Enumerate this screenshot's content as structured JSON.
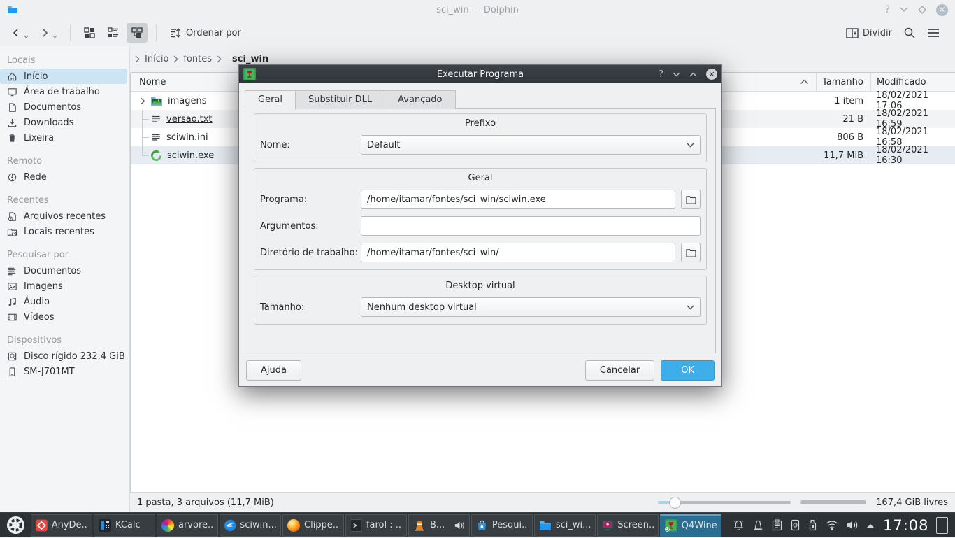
{
  "colors": {
    "accent": "#3daee9",
    "panel_bg": "#2c3136",
    "dialog_titlebar": "#31363b",
    "selection": "#cde4f5",
    "active_task": "#2b6d91"
  },
  "window": {
    "title": "sci_win — Dolphin",
    "help_glyph": "?"
  },
  "toolbar": {
    "sort_label": "Ordenar por",
    "split_label": "Dividir"
  },
  "breadcrumb": {
    "home": "Início",
    "parent": "fontes",
    "current": "sci_win"
  },
  "sidebar": {
    "sections": [
      {
        "title": "Locais",
        "items": [
          {
            "label": "Início",
            "icon": "home-icon",
            "selected": true
          },
          {
            "label": "Área de trabalho",
            "icon": "desktop-icon"
          },
          {
            "label": "Documentos",
            "icon": "documents-icon"
          },
          {
            "label": "Downloads",
            "icon": "downloads-icon"
          },
          {
            "label": "Lixeira",
            "icon": "trash-icon"
          }
        ]
      },
      {
        "title": "Remoto",
        "items": [
          {
            "label": "Rede",
            "icon": "network-icon"
          }
        ]
      },
      {
        "title": "Recentes",
        "items": [
          {
            "label": "Arquivos recentes",
            "icon": "recent-files-icon"
          },
          {
            "label": "Locais recentes",
            "icon": "recent-locations-icon"
          }
        ]
      },
      {
        "title": "Pesquisar por",
        "items": [
          {
            "label": "Documentos",
            "icon": "document-search-icon"
          },
          {
            "label": "Imagens",
            "icon": "images-icon"
          },
          {
            "label": "Áudio",
            "icon": "audio-icon"
          },
          {
            "label": "Vídeos",
            "icon": "videos-icon"
          }
        ]
      },
      {
        "title": "Dispositivos",
        "items": [
          {
            "label": "Disco rígido 232,4 GiB",
            "icon": "harddisk-icon"
          },
          {
            "label": "SM-J701MT",
            "icon": "phone-icon"
          }
        ]
      }
    ]
  },
  "filelist": {
    "columns": {
      "name": "Nome",
      "size": "Tamanho",
      "modified": "Modificado"
    },
    "rows": [
      {
        "name": "imagens",
        "size": "1 item",
        "modified": "18/02/2021 17:06",
        "icon": "folder-images-icon"
      },
      {
        "name": "versao.txt",
        "size": "21 B",
        "modified": "18/02/2021 16:59",
        "icon": "text-file-icon"
      },
      {
        "name": "sciwin.ini",
        "size": "806 B",
        "modified": "18/02/2021 16:58",
        "icon": "text-file-icon"
      },
      {
        "name": "sciwin.exe",
        "size": "11,7 MiB",
        "modified": "18/02/2021 16:30",
        "icon": "wine-exe-icon"
      }
    ]
  },
  "statusbar": {
    "summary": "1 pasta, 3 arquivos (11,7 MiB)",
    "free": "167,4 GiB livres"
  },
  "dialog": {
    "title": "Executar Programa",
    "help_glyph": "?",
    "tabs": [
      {
        "label": "Geral"
      },
      {
        "label": "Substituir DLL"
      },
      {
        "label": "Avançado"
      }
    ],
    "prefix_group": {
      "title": "Prefixo",
      "name_label": "Nome:",
      "name_value": "Default"
    },
    "general_group": {
      "title": "Geral",
      "program_label": "Programa:",
      "program_value": "/home/itamar/fontes/sci_win/sciwin.exe",
      "arguments_label": "Argumentos:",
      "arguments_value": "",
      "workdir_label": "Diretório de trabalho:",
      "workdir_value": "/home/itamar/fontes/sci_win/"
    },
    "desktop_group": {
      "title": "Desktop virtual",
      "size_label": "Tamanho:",
      "size_value": "Nenhum desktop virtual"
    },
    "footer": {
      "help": "Ajuda",
      "cancel": "Cancelar",
      "ok": "OK"
    }
  },
  "taskbar": {
    "clock": "17:08",
    "tasks": [
      {
        "label": "AnyDe...",
        "icon": "anydesk-icon"
      },
      {
        "label": "KCalc",
        "icon": "kcalc-icon"
      },
      {
        "label": "arvore...",
        "icon": "image-editor-icon"
      },
      {
        "label": "sciwin....",
        "icon": "sciwin-app-icon"
      },
      {
        "label": "Clippe...",
        "icon": "firefox-icon"
      },
      {
        "label": "farol : ...",
        "icon": "konsole-icon"
      },
      {
        "label": "B...",
        "icon": "vlc-icon"
      },
      {
        "label": "Pesqui...",
        "icon": "discover-icon"
      },
      {
        "label": "sci_wi...",
        "icon": "dolphin-icon"
      },
      {
        "label": "Screen...",
        "icon": "spectacle-icon"
      },
      {
        "label": "Q4Wine",
        "icon": "q4wine-icon",
        "active": true
      }
    ]
  }
}
